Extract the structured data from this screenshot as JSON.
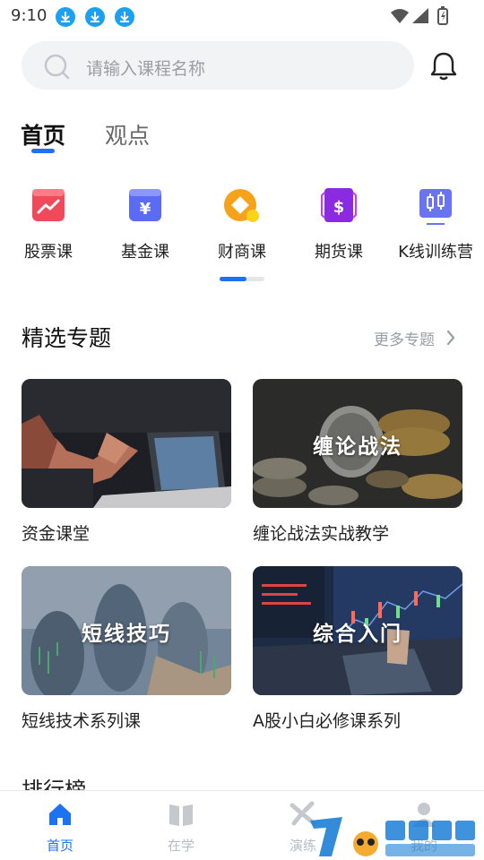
{
  "status_bar": {
    "time": "9:10"
  },
  "search": {
    "placeholder": "请输入课程名称"
  },
  "top_tabs": [
    {
      "label": "首页",
      "active": true
    },
    {
      "label": "观点",
      "active": false
    }
  ],
  "categories": [
    {
      "label": "股票课",
      "icon": "stock-chart-icon",
      "color": "#f04a5a"
    },
    {
      "label": "基金课",
      "icon": "fund-yen-icon",
      "color": "#5b6cf2"
    },
    {
      "label": "财商课",
      "icon": "finance-coin-icon",
      "color": "#f6a21a"
    },
    {
      "label": "期货课",
      "icon": "futures-dollar-icon",
      "color": "#8a2be2"
    },
    {
      "label": "K线训练营",
      "icon": "candlestick-icon",
      "color": "#6a74f0"
    }
  ],
  "category_pager": {
    "page": 1,
    "pages": 2
  },
  "featured": {
    "title": "精选专题",
    "more_label": "更多专题",
    "cards": [
      {
        "overlay": "",
        "caption": "资金课堂"
      },
      {
        "overlay": "缠论战法",
        "caption": "缠论战法实战教学"
      },
      {
        "overlay": "短线技巧",
        "caption": "短线技术系列课"
      },
      {
        "overlay": "综合入门",
        "caption": "A股小白必修课系列"
      }
    ]
  },
  "ranking": {
    "title": "排行榜"
  },
  "bottom_nav": [
    {
      "label": "首页",
      "icon": "home-icon",
      "active": true
    },
    {
      "label": "在学",
      "icon": "book-icon",
      "active": false
    },
    {
      "label": "演练",
      "icon": "plane-icon",
      "active": false
    },
    {
      "label": "我的",
      "icon": "person-icon",
      "active": false
    }
  ],
  "colors": {
    "accent": "#1d72f2",
    "inactive": "#b7bac0"
  }
}
